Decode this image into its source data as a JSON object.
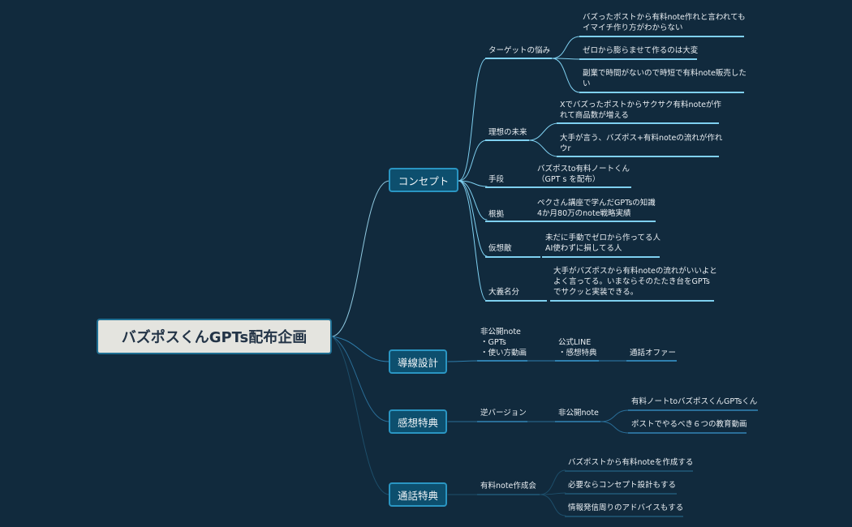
{
  "central": "バズポスくんGPTs配布企画",
  "branches": {
    "concept": {
      "label": "コンセプト",
      "worries": {
        "label": "ターゲットの悩み",
        "items": [
          "バズったポストから有料note作れと言われても\nイマイチ作り方がわからない",
          "ゼロから膨らませて作るのは大変",
          "副業で時間がないので時短で有料note販売した\nい"
        ]
      },
      "ideal": {
        "label": "理想の未来",
        "items": [
          "Xでバズったポストからサクサク有料noteが作\nれて商品数が増える",
          "大手が言う、バズポス+有料noteの流れが作れ\nウr"
        ]
      },
      "means": {
        "label": "手段",
        "text": "バズポスto有料ノートくん\n（GPT s を配布）"
      },
      "basis": {
        "label": "根拠",
        "text": "ペクさん講座で学んだGPTsの知識\n4か月80万のnote戦略実績"
      },
      "enemy": {
        "label": "仮想敵",
        "text": "未だに手動でゼロから作ってる人\nAI使わずに損してる人"
      },
      "cause": {
        "label": "大義名分",
        "text": "大手がバズポスから有料noteの流れがいいよと\nよく言ってる。いまならそのたたき台をGPTs\nでサクッと実装できる。"
      }
    },
    "funnel": {
      "label": "導線設計",
      "step1": "非公開note\n・GPTs\n・使い方動画",
      "step2": "公式LINE\n・感想特典",
      "step3": "通話オファー"
    },
    "review": {
      "label": "感想特典",
      "step1": "逆バージョン",
      "step2": "非公開note",
      "items": [
        "有料ノートtoバズポスくんGPTsくん",
        "ポストでやるべき６つの教育動画"
      ]
    },
    "call": {
      "label": "通話特典",
      "step1": "有料note作成会",
      "items": [
        "バズポストから有料noteを作成する",
        "必要ならコンセプト設計もする",
        "情報発信周りのアドバイスもする"
      ]
    }
  },
  "colors": {
    "background": "#112a3d",
    "central_fill": "#e4e4df",
    "central_border": "#1f6f93",
    "main_fill": "#0d4f6e",
    "main_border": "#2a95c2",
    "concept_line": "#7fd0f0",
    "funnel_line": "#2f7fae",
    "review_line": "#2a6e98",
    "call_line": "#1d4e6a"
  }
}
